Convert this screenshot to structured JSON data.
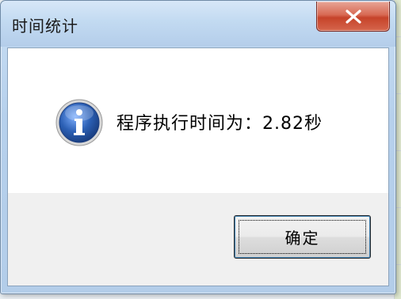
{
  "dialog": {
    "title": "时间统计",
    "message": "程序执行时间为：2.82秒",
    "ok_label": "确定",
    "close_icon": "close-icon",
    "message_icon": "info-icon"
  },
  "colors": {
    "close_button": "#c6432a",
    "info_icon_blue": "#2b5fb4",
    "frame": "#b6d0ec"
  }
}
